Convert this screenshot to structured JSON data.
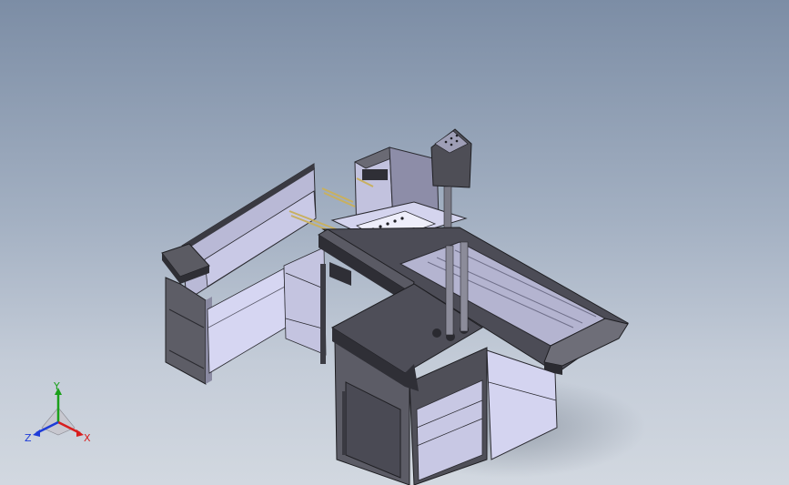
{
  "triad": {
    "x_label": "X",
    "y_label": "Y",
    "z_label": "Z",
    "x_color": "#d81e1e",
    "y_color": "#1aa01a",
    "z_color": "#1e3cd8"
  },
  "model": {
    "light_face": "#e0e0f4",
    "mid_face": "#a9a9c2",
    "dark_face": "#4a4a52",
    "rod_color": "#c8b060"
  }
}
